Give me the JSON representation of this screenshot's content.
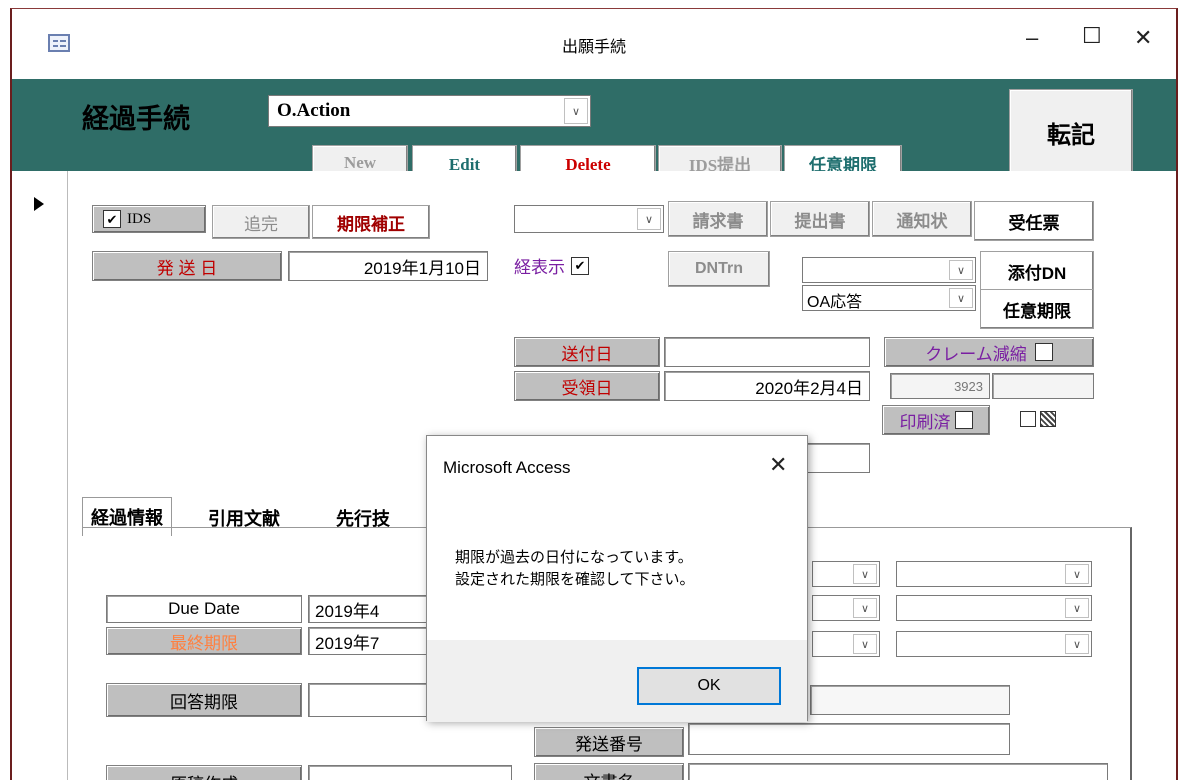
{
  "window": {
    "title": "出願手続",
    "minimize": "–",
    "maximize": "☐",
    "close": "✕"
  },
  "header": {
    "title": "経過手続",
    "action_combo": "O.Action",
    "tenki_button": "転記",
    "buttons": {
      "new": "New",
      "edit": "Edit",
      "delete": "Delete",
      "ids": "IDS提出",
      "nini": "任意期限"
    }
  },
  "detail": {
    "ids_label": "IDS",
    "tsuikan": "追完",
    "kigen_hosei": "期限補正",
    "hassobi_label": "発 送 日",
    "hassobi_value": "2019年1月10日",
    "kei_hyoji": "経表示",
    "buttons": {
      "seikyusho": "請求書",
      "teishutsusho": "提出書",
      "tsuchijo": "通知状",
      "juninhyo": "受任票",
      "dntrn": "DNTrn",
      "tenpu_dn": "添付DN",
      "nini_kigen": "任意期限"
    },
    "oa_combo": "OA応答",
    "sofubi_label": "送付日",
    "sofubi_value": "",
    "juryobi_label": "受領日",
    "juryobi_value": "2020年2月4日",
    "claim_label": "クレーム減縮",
    "num_value": "3923",
    "insatsu_label": "印刷済",
    "tabs": [
      "経過情報",
      "引用文献",
      "先行技"
    ],
    "due_date_label": "Due Date",
    "due_date_value": "2019年4",
    "saishu_label": "最終期限",
    "saishu_value": "2019年7",
    "kaito_label": "回答期限",
    "hasso_bango_label": "発送番号",
    "genko_label": "原稿作成",
    "bunsho_label": "文書名"
  },
  "dialog": {
    "title": "Microsoft Access",
    "close": "✕",
    "line1": "期限が過去の日付になっています。",
    "line2": "設定された期限を確認して下さい。",
    "ok": "OK"
  }
}
